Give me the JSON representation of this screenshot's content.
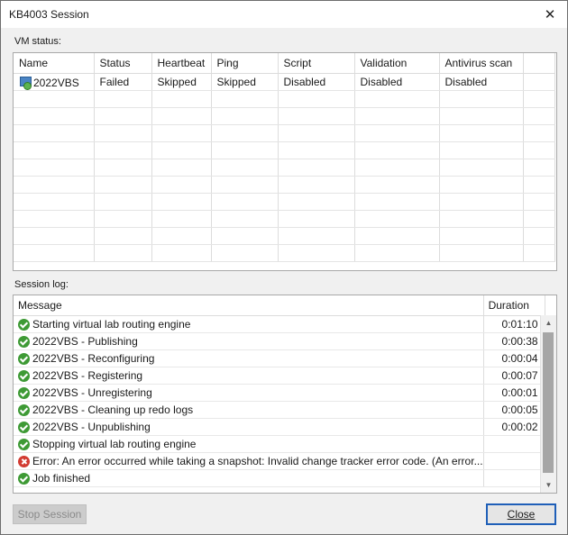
{
  "window": {
    "title": "KB4003 Session"
  },
  "vm_status": {
    "label": "VM status:",
    "columns": [
      "Name",
      "Status",
      "Heartbeat",
      "Ping",
      "Script",
      "Validation",
      "Antivirus scan"
    ],
    "rows": [
      {
        "name": "2022VBS",
        "status": "Failed",
        "heartbeat": "Skipped",
        "ping": "Skipped",
        "script": "Disabled",
        "validation": "Disabled",
        "antivirus": "Disabled"
      }
    ]
  },
  "session_log": {
    "label": "Session log:",
    "columns": [
      "Message",
      "Duration"
    ],
    "rows": [
      {
        "icon": "check-circle-icon",
        "message": "Starting virtual lab routing engine",
        "duration": "0:01:10"
      },
      {
        "icon": "check-circle-icon",
        "message": "2022VBS - Publishing",
        "duration": "0:00:38"
      },
      {
        "icon": "check-circle-icon",
        "message": "2022VBS - Reconfiguring",
        "duration": "0:00:04"
      },
      {
        "icon": "check-circle-icon",
        "message": "2022VBS - Registering",
        "duration": "0:00:07"
      },
      {
        "icon": "check-circle-icon",
        "message": "2022VBS - Unregistering",
        "duration": "0:00:01"
      },
      {
        "icon": "check-circle-icon",
        "message": "2022VBS - Cleaning up redo logs",
        "duration": "0:00:05"
      },
      {
        "icon": "check-circle-icon",
        "message": "2022VBS - Unpublishing",
        "duration": "0:00:02"
      },
      {
        "icon": "check-circle-icon",
        "message": "Stopping virtual lab routing engine",
        "duration": ""
      },
      {
        "icon": "error-circle-icon",
        "message": "Error: An error occurred while taking a snapshot: Invalid change tracker error code. (An error...",
        "duration": ""
      },
      {
        "icon": "check-circle-icon",
        "message": "Job finished",
        "duration": ""
      }
    ]
  },
  "buttons": {
    "stop_session": "Stop Session",
    "close": "Close"
  },
  "colors": {
    "success": "#3e9a35",
    "error": "#d23b32",
    "accent_border": "#1f5fb8"
  }
}
